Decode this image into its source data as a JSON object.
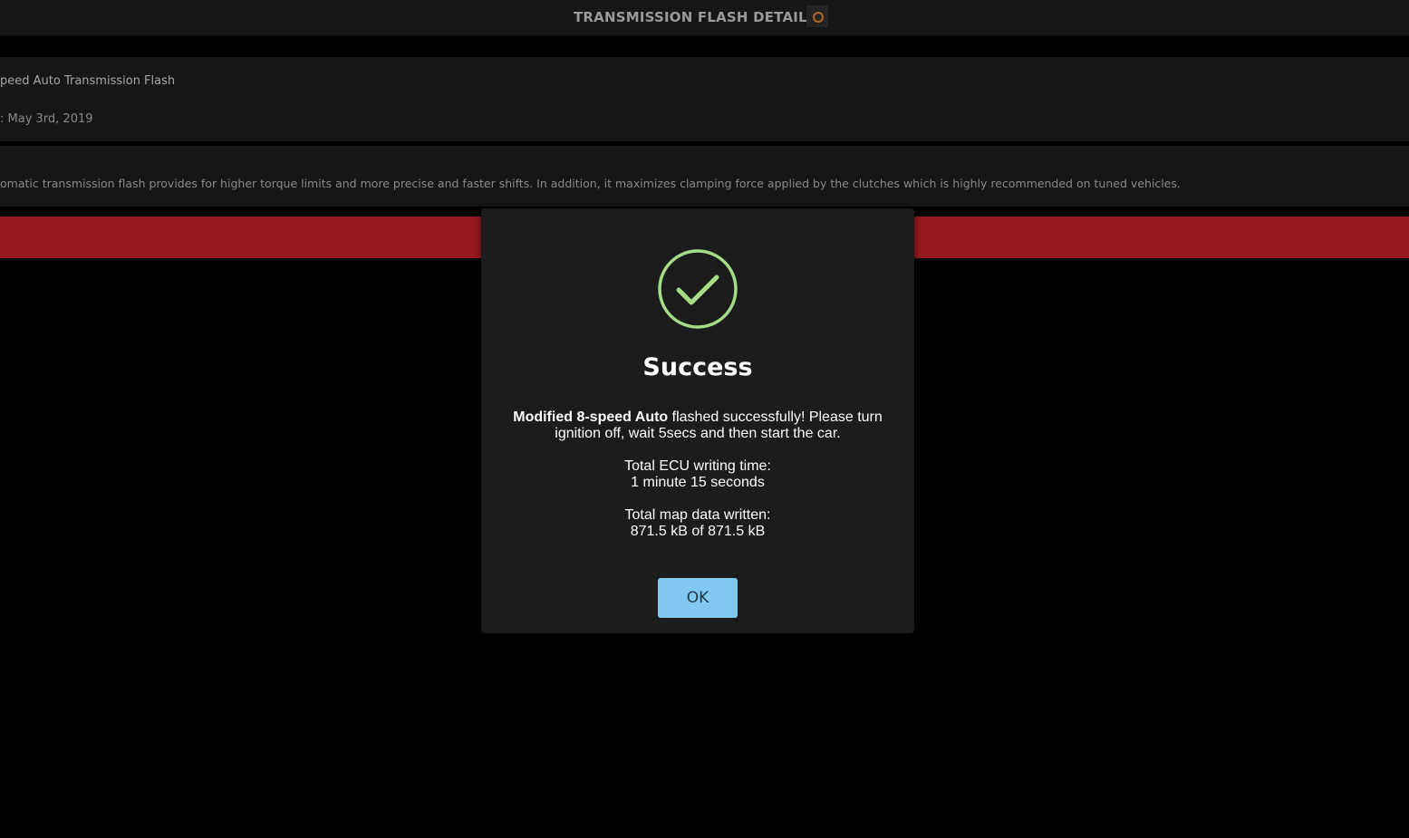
{
  "header": {
    "title": "TRANSMISSION FLASH DETAILS",
    "icon": "record-icon",
    "icon_color": "#b5651d"
  },
  "details": {
    "name": "peed Auto Transmission Flash",
    "date": ": May 3rd, 2019",
    "description": "omatic transmission flash provides for higher torque limits and more precise and faster shifts. In addition, it maximizes clamping force applied by the clutches which is highly recommended on tuned vehicles."
  },
  "action_bar": {
    "color": "#951b1f"
  },
  "modal": {
    "icon": "check-circle-icon",
    "icon_color": "#a5dc86",
    "title": "Success",
    "message_bold": "Modified 8-speed Auto",
    "message_rest": " flashed successfully! Please turn ignition off, wait 5secs and then start the car.",
    "writing_time_label": "Total ECU writing time:",
    "writing_time_value": "1 minute 15 seconds",
    "map_data_label": "Total map data written:",
    "map_data_value": "871.5 kB of 871.5 kB",
    "ok_label": "OK",
    "ok_color": "#81c8f1"
  }
}
